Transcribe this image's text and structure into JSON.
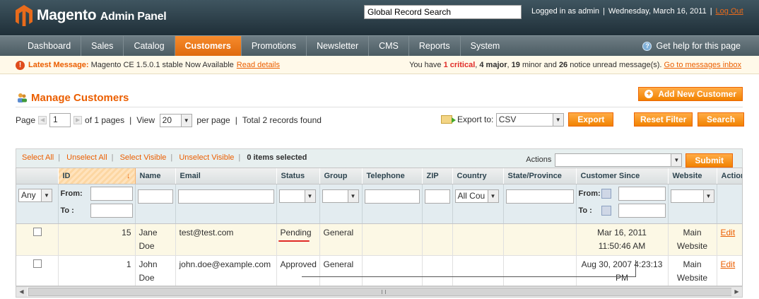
{
  "header": {
    "brand_main": "Magento",
    "brand_sub": "Admin Panel",
    "search_value": "Global Record Search",
    "logged_in": "Logged in as admin",
    "date": "Wednesday, March 16, 2011",
    "logout": "Log Out"
  },
  "nav": {
    "items": [
      "Dashboard",
      "Sales",
      "Catalog",
      "Customers",
      "Promotions",
      "Newsletter",
      "CMS",
      "Reports",
      "System"
    ],
    "active": "Customers",
    "help": "Get help for this page"
  },
  "message": {
    "label": "Latest Message:",
    "text": "Magento CE 1.5.0.1 stable Now Available",
    "link": "Read details",
    "right_prefix": "You have",
    "critical": "1 critical",
    "major": "4 major",
    "minor": "19",
    "minor_suffix": "minor and",
    "notice": "26",
    "notice_suffix": "notice unread message(s).",
    "inbox_link": "Go to messages inbox"
  },
  "page": {
    "title": "Manage Customers",
    "add_button": "Add New Customer"
  },
  "pager": {
    "page_label": "Page",
    "page_value": "1",
    "of_pages": "of 1 pages",
    "view_label": "View",
    "view_value": "20",
    "per_page": "per page",
    "total": "Total 2 records found",
    "export_label": "Export to:",
    "export_format": "CSV",
    "export_button": "Export",
    "reset_button": "Reset Filter",
    "search_button": "Search"
  },
  "massaction": {
    "select_all": "Select All",
    "unselect_all": "Unselect All",
    "select_visible": "Select Visible",
    "unselect_visible": "Unselect Visible",
    "selected": "0 items selected",
    "actions_label": "Actions",
    "submit": "Submit"
  },
  "columns": [
    "ID",
    "Name",
    "Email",
    "Status",
    "Group",
    "Telephone",
    "ZIP",
    "Country",
    "State/Province",
    "Customer Since",
    "Website",
    "Action"
  ],
  "filter": {
    "any": "Any",
    "from": "From:",
    "to": "To :",
    "country": "All Cou"
  },
  "rows": [
    {
      "id": "15",
      "name": "Jane Doe",
      "email": "test@test.com",
      "status": "Pending",
      "group": "General",
      "since_date": "Mar 16, 2011",
      "since_time": "11:50:46 AM",
      "website": "Main Website",
      "action": "Edit"
    },
    {
      "id": "1",
      "name": "John Doe",
      "email": "john.doe@example.com",
      "status": "Approved",
      "group": "General",
      "since_date": "Aug 30, 2007 4:23:13",
      "since_time": "PM",
      "website": "Main Website",
      "action": "Edit"
    }
  ],
  "colors": {
    "accent": "#eb5e00",
    "header_bg": "#2f4550",
    "nav_active": "#f18200"
  }
}
